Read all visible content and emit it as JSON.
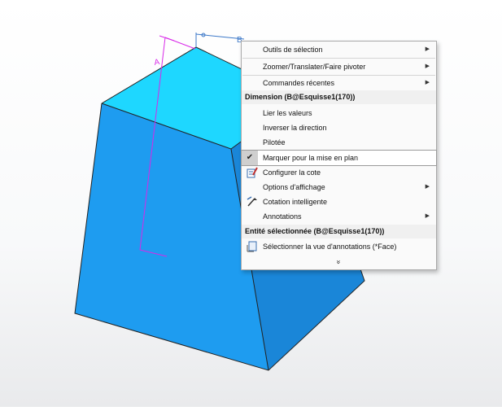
{
  "viewport": {
    "dimension_labels": [
      "A",
      "B"
    ],
    "cube_colors": {
      "top": "#1ed7ff",
      "left": "#1e9cf0",
      "right": "#1a86d8"
    },
    "sketch_color": "#d828e8"
  },
  "context_menu": {
    "items_top": [
      {
        "label": "Outils de sélection",
        "submenu": true
      },
      {
        "label": "Zoomer/Translater/Faire pivoter",
        "submenu": true
      },
      {
        "label": "Commandes récentes",
        "submenu": true
      }
    ],
    "dimension_header": "Dimension (B@Esquisse1(170))",
    "dimension_items": [
      {
        "label": "Lier les valeurs"
      },
      {
        "label": "Inverser la direction"
      },
      {
        "label": "Pilotée"
      },
      {
        "label": "Marquer pour la mise en plan",
        "checked": true,
        "icon": "check-icon"
      },
      {
        "label": "Configurer la cote",
        "icon": "configure-dimension-icon"
      },
      {
        "label": "Options d'affichage",
        "submenu": true
      },
      {
        "label": "Cotation intelligente",
        "icon": "smart-dimension-icon"
      },
      {
        "label": "Annotations",
        "submenu": true
      }
    ],
    "entity_header": "Entité sélectionnée (B@Esquisse1(170))",
    "entity_items": [
      {
        "label": "Sélectionner la vue d'annotations (*Face)",
        "icon": "annotation-view-icon"
      }
    ],
    "more_icon": "double-chevron-down-icon",
    "more_glyph": "»"
  },
  "annotation": {
    "arrow_color": "#d0141c"
  }
}
